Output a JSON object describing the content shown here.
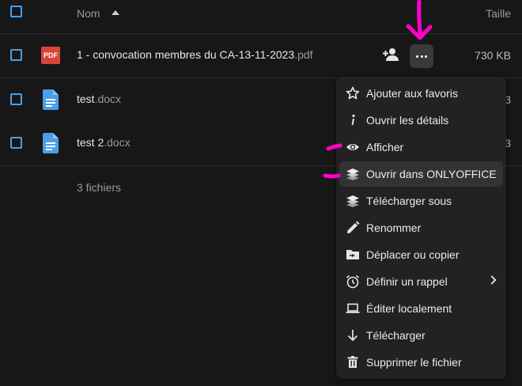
{
  "header": {
    "name_col": "Nom",
    "size_col": "Taille"
  },
  "files": [
    {
      "base": "1 - convocation membres du CA-13-11-2023",
      "ext": ".pdf",
      "size": "730 KB",
      "icon": "pdf-icon",
      "icon_text": "PDF"
    },
    {
      "base": "test",
      "ext": ".docx",
      "size": "3",
      "icon": "document-icon"
    },
    {
      "base": "test 2",
      "ext": ".docx",
      "size": "3",
      "icon": "document-icon"
    }
  ],
  "summary": "3 fichiers",
  "menu": {
    "items": [
      {
        "label": "Ajouter aux favoris",
        "icon": "star-icon"
      },
      {
        "label": "Ouvrir les détails",
        "icon": "info-icon"
      },
      {
        "label": "Afficher",
        "icon": "eye-icon"
      },
      {
        "label": "Ouvrir dans ONLYOFFICE",
        "icon": "onlyoffice-icon"
      },
      {
        "label": "Télécharger sous",
        "icon": "onlyoffice-icon"
      },
      {
        "label": "Renommer",
        "icon": "pencil-icon"
      },
      {
        "label": "Déplacer ou copier",
        "icon": "folder-move-icon"
      },
      {
        "label": "Définir un rappel",
        "icon": "alarm-icon"
      },
      {
        "label": "Éditer localement",
        "icon": "laptop-icon"
      },
      {
        "label": "Télécharger",
        "icon": "download-icon"
      },
      {
        "label": "Supprimer le fichier",
        "icon": "trash-icon"
      }
    ]
  },
  "colors": {
    "accent": "#4a9fe6",
    "annotation": "#ff00cc",
    "pdf": "#d9443a",
    "menu_bg": "#222222"
  }
}
